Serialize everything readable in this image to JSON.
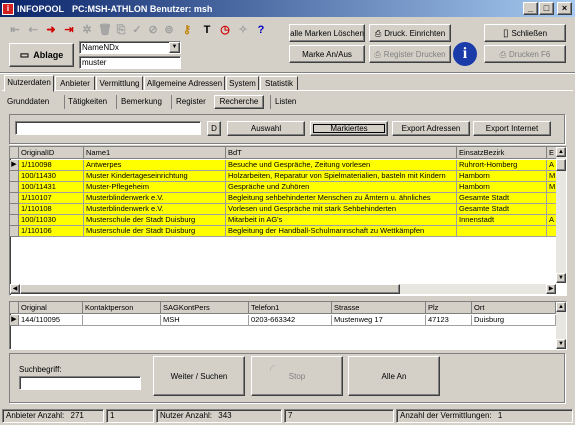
{
  "title": {
    "app": "INFOPOOL",
    "info": "PC:MSH-ATHLON Benutzer: msh"
  },
  "toolbar": {
    "ablage": "Ablage",
    "dropdown_value": "NameNDx",
    "search_value": "muster",
    "alle_marken": "alle Marken Löschen",
    "marke_an_aus": "Marke An/Aus",
    "druck_einrichten": "Druck. Einrichten",
    "register_drucken": "Register Drucken",
    "schliessen": "Schließen",
    "drucken_f6": "Drucken F6"
  },
  "main_tabs": [
    "Nutzerdaten",
    "Anbieter",
    "Vermittlung",
    "Allgemeine Adressen",
    "System",
    "Statistik"
  ],
  "sub_tabs": [
    "Grunddaten",
    "Tätigkeiten",
    "Bemerkung",
    "Register",
    "Recherche",
    "Listen"
  ],
  "filter": {
    "input_value": "",
    "d_label": "D",
    "auswahl": "Auswahl",
    "markiertes": "Markiertes",
    "export_adressen": "Export Adressen",
    "export_internet": "Export Internet"
  },
  "grid1": {
    "headers": [
      "OriginalID",
      "Name1",
      "BdT",
      "EinsatzBezirk",
      "E"
    ],
    "rows": [
      [
        "1/110098",
        "Antwerpes",
        "Besuche und Gespräche, Zeitung vorlesen",
        "Ruhrort-Homberg",
        "A"
      ],
      [
        "100/11430",
        "Muster Kindertageseinrichtung",
        "Holzarbeiten, Reparatur von Spielmaterialien, basteln mit Kindern",
        "Hamborn",
        "M"
      ],
      [
        "100/11431",
        "Muster-Pflegeheim",
        "Gespräche und Zuhören",
        "Hamborn",
        "M"
      ],
      [
        "1/110107",
        "Musterblindenwerk e.V.",
        "Begleitung sehbehinderter Menschen zu Ämtern u. ähnliches",
        "Gesamte Stadt",
        ""
      ],
      [
        "1/110108",
        "Musterblindenwerk e.V.",
        "Vorlesen und Gespräche mit stark Sehbehinderten",
        "Gesamte Stadt",
        ""
      ],
      [
        "100/11030",
        "Musterschule der Stadt Duisburg",
        "Mitarbeit in AG's",
        "Innenstadt",
        "A"
      ],
      [
        "1/110106",
        "Musterschule der Stadt Duisburg",
        "Begleitung der Handball-Schulmannschaft zu Wettkämpfen",
        "",
        ""
      ]
    ]
  },
  "grid2": {
    "headers": [
      "Original",
      "Kontaktperson",
      "SAGKontPers",
      "Telefon1",
      "Strasse",
      "Plz",
      "Ort"
    ],
    "rows": [
      [
        "144/110095",
        "",
        "MSH",
        "0203-663342",
        "Mustenweg 17",
        "47123",
        "Duisburg"
      ]
    ]
  },
  "bottom": {
    "suchbegriff": "Suchbegriff:",
    "weiter": "Weiter / Suchen",
    "stop": "Stop",
    "alle_an": "Alle An"
  },
  "status": {
    "anbieter_label": "Anbieter Anzahl:",
    "anbieter_count": "271",
    "page": "1",
    "nutzer_label": "Nutzer Anzahl:",
    "nutzer_count": "343",
    "nutzer_val": "7",
    "vermittlungen_label": "Anzahl der Vermittlungen:",
    "vermittlungen_count": "1"
  },
  "colors": {
    "highlight": "#ffff00",
    "titlebar": "#0a246a"
  }
}
